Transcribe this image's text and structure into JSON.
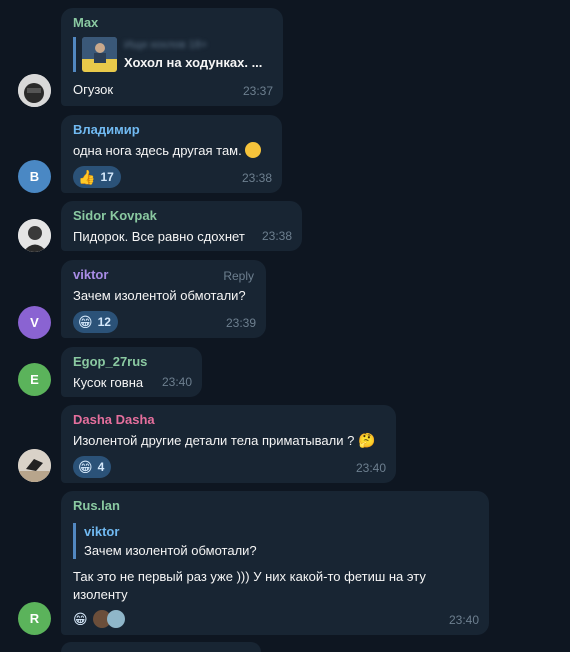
{
  "messages": [
    {
      "sender": "Max",
      "sender_color": "#8ac9a1",
      "forward": {
        "channel": "Ищи хохлов 18+",
        "title": "Хохол на ходунках. ..."
      },
      "text": "Огузок",
      "time": "23:37"
    },
    {
      "sender": "Владимир",
      "sender_color": "#71baf2",
      "avatar_letter": "В",
      "avatar_color": "#4a88c4",
      "text": "одна нога здесь другая там.",
      "reaction": {
        "emoji": "👍",
        "count": "17"
      },
      "time": "23:38"
    },
    {
      "sender": "Sidor Kovpak",
      "sender_color": "#8ac9a1",
      "text": "Пидорок. Все равно сдохнет",
      "time": "23:38"
    },
    {
      "sender": "viktor",
      "sender_color": "#a88ce6",
      "avatar_letter": "V",
      "avatar_color": "#8a63d2",
      "reply_label": "Reply",
      "text": "Зачем изолентой обмотали?",
      "reaction": {
        "emoji": "😁",
        "count": "12"
      },
      "time": "23:39"
    },
    {
      "sender": "Egop_27rus",
      "sender_color": "#8ac9a1",
      "avatar_letter": "E",
      "avatar_color": "#5bb35b",
      "text": "Кусок говна",
      "time": "23:40"
    },
    {
      "sender": "Dasha Dasha",
      "sender_color": "#e56f9d",
      "text": "Изолентой другие детали тела приматывали ?",
      "text_emoji": "🤔",
      "reaction": {
        "emoji": "😁",
        "count": "4"
      },
      "time": "23:40"
    },
    {
      "sender": "Rus.lan",
      "sender_color": "#8ac9a1",
      "avatar_letter": "R",
      "avatar_color": "#5bb35b",
      "quote": {
        "name": "viktor",
        "text": "Зачем изолентой обмотали?"
      },
      "text": "Так это не первый раз уже ))) У них какой-то фетиш на эту изоленту",
      "reaction": {
        "emoji": "😁"
      },
      "time": "23:40"
    }
  ],
  "colors": {
    "background": "#0e1621",
    "bubble": "#182533",
    "reaction_bg": "#2b5278",
    "time": "#6d7f8f"
  }
}
